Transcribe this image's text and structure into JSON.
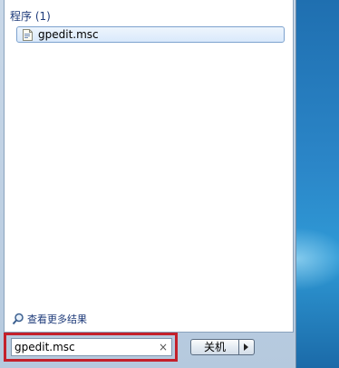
{
  "programs": {
    "heading": "程序 (1)",
    "items": [
      {
        "label": "gpedit.msc",
        "icon": "msc-file-icon"
      }
    ]
  },
  "more_results": {
    "label": "查看更多结果",
    "icon": "magnifier-icon"
  },
  "search": {
    "value": "gpedit.msc",
    "clear_glyph": "×",
    "highlight_color": "#c3202b"
  },
  "shutdown": {
    "label": "关机",
    "arrow_icon": "triangle-right-icon"
  },
  "colors": {
    "heading_text": "#1e3b7a",
    "selection_border": "#7da2ce"
  }
}
